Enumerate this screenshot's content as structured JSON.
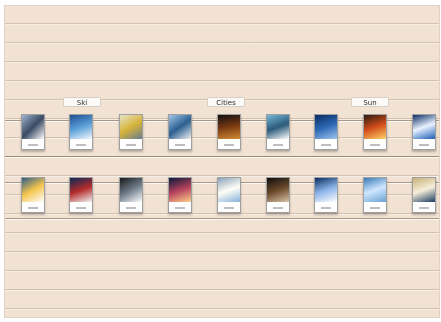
{
  "shelf": {
    "labels": [
      "Ski",
      "Cities",
      "Sun"
    ]
  },
  "brochures": {
    "top": [
      "brochure-ski-1",
      "brochure-ski-2",
      "brochure-ski-3",
      "brochure-cities-1",
      "brochure-cities-2",
      "brochure-cities-3",
      "brochure-sun-1",
      "brochure-sun-2",
      "brochure-sun-3"
    ],
    "bottom": [
      "brochure-ski-4",
      "brochure-ski-5",
      "brochure-ski-6",
      "brochure-cities-4",
      "brochure-cities-5",
      "brochure-cities-6",
      "brochure-sun-4",
      "brochure-sun-5",
      "brochure-sun-6"
    ]
  }
}
